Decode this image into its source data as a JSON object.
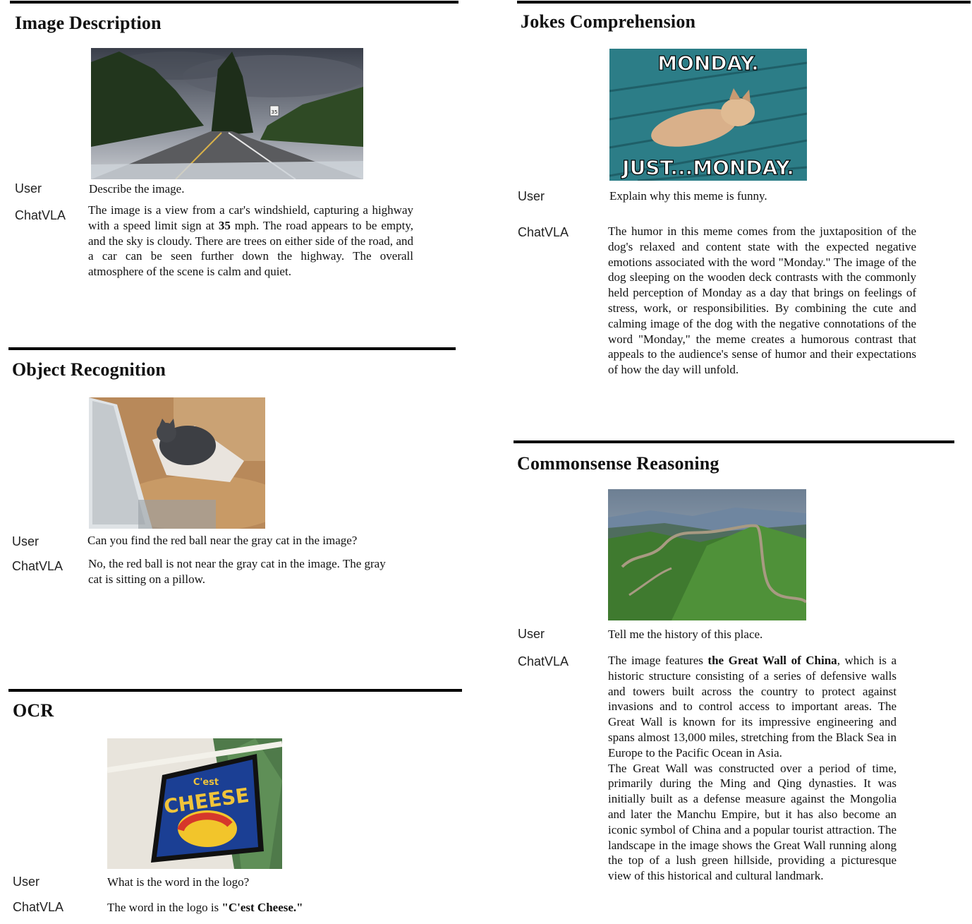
{
  "sections": {
    "image_description": {
      "title": "Image Description",
      "user_label": "User",
      "user_text": "Describe the image.",
      "model_label": "ChatVLA",
      "answer_pre": "The image is a view from a car's windshield, capturing a highway with a speed limit sign at ",
      "answer_bold": "35",
      "answer_post": " mph. The road appears to be empty, and the sky is cloudy. There are trees on either side of the road, and a car can be seen further down the highway. The overall atmosphere of the scene is calm and quiet.",
      "sign_text": "35"
    },
    "object_recognition": {
      "title": "Object Recognition",
      "user_label": "User",
      "user_text": "Can you find the red ball near the gray cat in the image?",
      "model_label": "ChatVLA",
      "answer": "No, the red ball is not near the gray cat in the image. The gray cat is sitting on a pillow."
    },
    "ocr": {
      "title": "OCR",
      "user_label": "User",
      "user_text": "What is the word in the logo?",
      "model_label": "ChatVLA",
      "answer_pre": "The word in the logo is ",
      "answer_bold": "\"C'est Cheese.\"",
      "logo_line1": "C'est",
      "logo_line2": "CHEESE"
    },
    "jokes": {
      "title": "Jokes Comprehension",
      "user_label": "User",
      "user_text": "Explain why this meme is funny.",
      "model_label": "ChatVLA",
      "answer": "The humor in this meme comes from the juxtaposition of the dog's relaxed and content state with the expected negative emotions associated with the word \"Monday.\" The image of the dog sleeping on the wooden deck contrasts with the commonly held perception of Monday as a day that brings on feelings of stress, work, or responsibilities. By combining the cute and calming image of the dog with the negative connotations of the word \"Monday,\" the meme creates a humorous contrast that appeals to the audience's sense of humor and their expectations of how the day will unfold.",
      "meme_top": "MONDAY.",
      "meme_bottom": "JUST...MONDAY."
    },
    "commonsense": {
      "title": "Commonsense Reasoning",
      "user_label": "User",
      "user_text": "Tell me the history of this place.",
      "model_label": "ChatVLA",
      "answer_pre": "The image features ",
      "answer_bold": "the Great Wall of China",
      "answer_post": ", which is a historic structure consisting of a series of defensive walls and towers built across the country to protect against invasions and to control access to important areas. The Great Wall is known for its impressive engineering and spans almost 13,000 miles, stretching from the Black Sea in Europe to the Pacific Ocean in Asia.",
      "answer_p2": "The Great Wall was constructed over a period of time, primarily during the Ming and Qing dynasties. It was initially built as a defense measure against the Mongolia and later the Manchu Empire, but it has also become an iconic symbol of China and a popular tourist attraction. The landscape in the image shows the Great Wall running along the top of a lush green hillside, providing a picturesque view of this historical and cultural landmark."
    }
  }
}
